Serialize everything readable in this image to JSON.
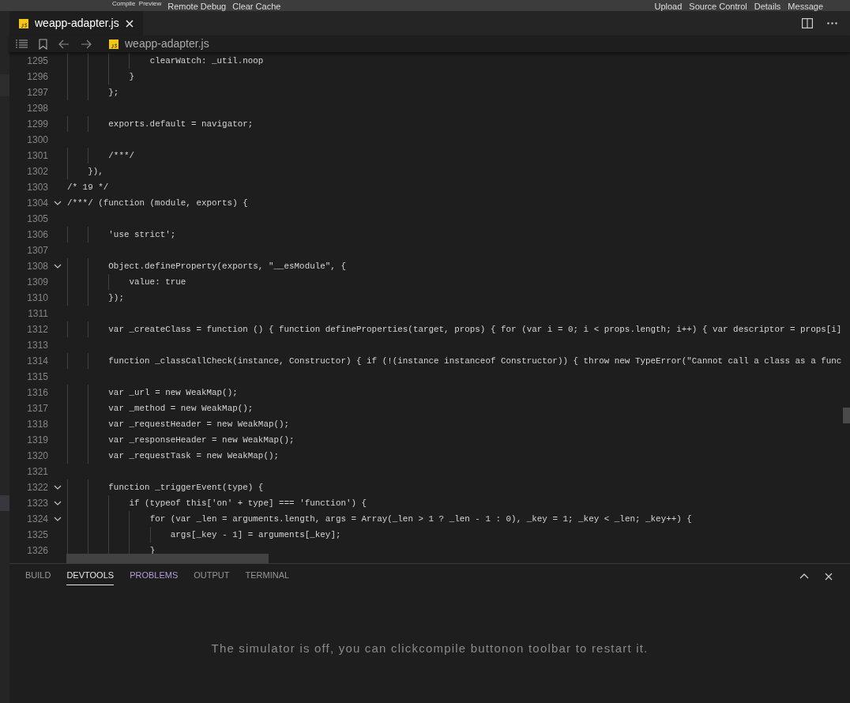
{
  "toolbar": {
    "left_items": [
      "Compile  Preview",
      "Remote Debug",
      "Clear Cache"
    ],
    "right_items": [
      "Upload",
      "Source Control",
      "Details",
      "Message"
    ]
  },
  "editor_tabs": [
    {
      "label": "weapp-adapter.js",
      "selected": true
    }
  ],
  "breadcrumb": {
    "file": "weapp-adapter.js"
  },
  "code_lines": [
    {
      "number": "1295",
      "text": "                clearWatch: _util.noop",
      "foldable": false
    },
    {
      "number": "1296",
      "text": "            }",
      "foldable": false
    },
    {
      "number": "1297",
      "text": "        };",
      "foldable": false
    },
    {
      "number": "1298",
      "foldable": false
    },
    {
      "number": "1299",
      "text": "        exports.default = navigator;",
      "foldable": false
    },
    {
      "number": "1300",
      "foldable": false
    },
    {
      "number": "1301",
      "text": "        /***/",
      "foldable": false
    },
    {
      "number": "1302",
      "text": "    }),",
      "foldable": false
    },
    {
      "number": "1303",
      "text": "/* 19 */",
      "foldable": false
    },
    {
      "number": "1304",
      "text": "/***/ (function (module, exports) {",
      "foldable": true
    },
    {
      "number": "1305",
      "foldable": false
    },
    {
      "number": "1306",
      "text": "        'use strict';",
      "foldable": false
    },
    {
      "number": "1307",
      "foldable": false
    },
    {
      "number": "1308",
      "text": "        Object.defineProperty(exports, \"__esModule\", {",
      "foldable": true
    },
    {
      "number": "1309",
      "text": "            value: true",
      "foldable": false
    },
    {
      "number": "1310",
      "text": "        });",
      "foldable": false
    },
    {
      "number": "1311",
      "foldable": false
    },
    {
      "number": "1312",
      "text": "        var _createClass = function () { function defineProperties(target, props) { for (var i = 0; i < props.length; i++) { var descriptor = props[i]",
      "foldable": false
    },
    {
      "number": "1313",
      "foldable": false
    },
    {
      "number": "1314",
      "text": "        function _classCallCheck(instance, Constructor) { if (!(instance instanceof Constructor)) { throw new TypeError(\"Cannot call a class as a func",
      "foldable": false
    },
    {
      "number": "1315",
      "foldable": false
    },
    {
      "number": "1316",
      "text": "        var _url = new WeakMap();",
      "foldable": false
    },
    {
      "number": "1317",
      "text": "        var _method = new WeakMap();",
      "foldable": false
    },
    {
      "number": "1318",
      "text": "        var _requestHeader = new WeakMap();",
      "foldable": false
    },
    {
      "number": "1319",
      "text": "        var _responseHeader = new WeakMap();",
      "foldable": false
    },
    {
      "number": "1320",
      "text": "        var _requestTask = new WeakMap();",
      "foldable": false
    },
    {
      "number": "1321",
      "foldable": false
    },
    {
      "number": "1322",
      "text": "        function _triggerEvent(type) {",
      "foldable": true
    },
    {
      "number": "1323",
      "text": "            if (typeof this['on' + type] === 'function') {",
      "foldable": true
    },
    {
      "number": "1324",
      "text": "                for (var _len = arguments.length, args = Array(_len > 1 ? _len - 1 : 0), _key = 1; _key < _len; _key++) {",
      "foldable": true
    },
    {
      "number": "1325",
      "text": "                    args[_key - 1] = arguments[_key];",
      "foldable": false
    },
    {
      "number": "1326",
      "text": "                }",
      "foldable": false
    }
  ],
  "panel": {
    "tabs": [
      {
        "label": "BUILD",
        "selected": false
      },
      {
        "label": "DEVTOOLS",
        "selected": true
      },
      {
        "label": "PROBLEMS",
        "selected": false
      },
      {
        "label": "OUTPUT",
        "selected": false
      },
      {
        "label": "TERMINAL",
        "selected": false
      }
    ],
    "message": "The simulator is off, you can clickcompile buttonon toolbar to restart it."
  }
}
